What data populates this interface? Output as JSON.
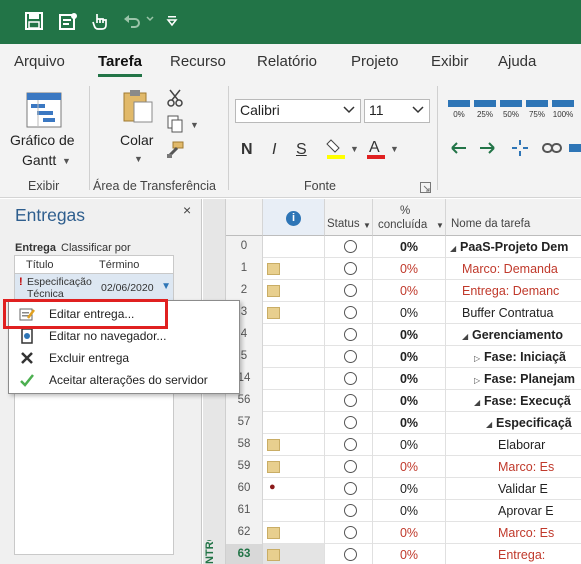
{
  "quick_access": {
    "icons": [
      "save-icon",
      "new-from-template-icon",
      "touch-mode-icon",
      "undo-icon",
      "redo-icon",
      "customize-qat-icon"
    ]
  },
  "tabs": [
    "Arquivo",
    "Tarefa",
    "Recurso",
    "Relatório",
    "Projeto",
    "Exibir",
    "Ajuda"
  ],
  "active_tab": "Tarefa",
  "ribbon": {
    "view_group": {
      "gantt_label_line1": "Gráfico de",
      "gantt_label_line2": "Gantt",
      "group_label": "Exibir"
    },
    "clipboard_group": {
      "paste_label": "Colar",
      "group_label": "Área de Transferência"
    },
    "font_group": {
      "font_name": "Calibri",
      "font_size": "11",
      "bold": "N",
      "italic": "I",
      "underline": "S",
      "group_label": "Fonte"
    },
    "schedule_group": {
      "percent_buttons": [
        "0%",
        "25%",
        "50%",
        "75%",
        "100%"
      ]
    }
  },
  "panel": {
    "title": "Entregas",
    "close": "×",
    "subtitle_entrega": "Entrega",
    "subtitle_sort": "Classificar por",
    "col_title": "Título",
    "col_end": "Término",
    "item": {
      "flag": "!",
      "title": "Especificação Técnica",
      "date": "02/06/2020"
    }
  },
  "context_menu": {
    "items": [
      {
        "label": "Editar entrega...",
        "icon": "edit-deliverable-icon"
      },
      {
        "label": "Editar no navegador...",
        "icon": "browser-icon"
      },
      {
        "label": "Excluir entrega",
        "icon": "delete-x-icon"
      },
      {
        "label": "Aceitar alterações do servidor",
        "icon": "checkmark-icon"
      }
    ]
  },
  "grid": {
    "headers": {
      "info": "i",
      "status": "Status",
      "pct_line1": "%",
      "pct_line2": "concluída",
      "name": "Nome da tarefa"
    },
    "side_label": "NTROLE",
    "rows": [
      {
        "id": "0",
        "indicator": "",
        "pct": "0%",
        "name": "PaaS-Projeto Dem",
        "style": "summary",
        "indent": 0,
        "collapse": "down"
      },
      {
        "id": "1",
        "indicator": "note",
        "pct": "0%",
        "name": "Marco: Demanda",
        "style": "red",
        "indent": 1,
        "collapse": ""
      },
      {
        "id": "2",
        "indicator": "note",
        "pct": "0%",
        "name": "Entrega: Demanc",
        "style": "red",
        "indent": 1,
        "collapse": ""
      },
      {
        "id": "3",
        "indicator": "note",
        "pct": "0%",
        "name": "Buffer Contratua",
        "style": "normal",
        "indent": 1,
        "collapse": ""
      },
      {
        "id": "4",
        "indicator": "",
        "pct": "0%",
        "name": "Gerenciamento",
        "style": "summary",
        "indent": 1,
        "collapse": "down"
      },
      {
        "id": "5",
        "indicator": "",
        "pct": "0%",
        "name": "Fase: Iniciaçã",
        "style": "summary",
        "indent": 2,
        "collapse": "right"
      },
      {
        "id": "14",
        "indicator": "",
        "pct": "0%",
        "name": "Fase: Planejam",
        "style": "summary",
        "indent": 2,
        "collapse": "right"
      },
      {
        "id": "56",
        "indicator": "",
        "pct": "0%",
        "name": "Fase: Execuçã",
        "style": "summary",
        "indent": 2,
        "collapse": "down"
      },
      {
        "id": "57",
        "indicator": "",
        "pct": "0%",
        "name": "Especificaçã",
        "style": "summary",
        "indent": 3,
        "collapse": "down"
      },
      {
        "id": "58",
        "indicator": "note",
        "pct": "0%",
        "name": "Elaborar",
        "style": "normal",
        "indent": 4,
        "collapse": ""
      },
      {
        "id": "59",
        "indicator": "note",
        "pct": "0%",
        "name": "Marco: Es",
        "style": "red",
        "indent": 4,
        "collapse": ""
      },
      {
        "id": "60",
        "indicator": "resource",
        "pct": "0%",
        "name": "Validar E",
        "style": "normal",
        "indent": 4,
        "collapse": ""
      },
      {
        "id": "61",
        "indicator": "",
        "pct": "0%",
        "name": "Aprovar E",
        "style": "normal",
        "indent": 4,
        "collapse": ""
      },
      {
        "id": "62",
        "indicator": "note",
        "pct": "0%",
        "name": "Marco: Es",
        "style": "red",
        "indent": 4,
        "collapse": ""
      },
      {
        "id": "63",
        "indicator": "note",
        "pct": "0%",
        "name": "Entrega:",
        "style": "red",
        "indent": 4,
        "collapse": "",
        "selected": true
      }
    ]
  }
}
